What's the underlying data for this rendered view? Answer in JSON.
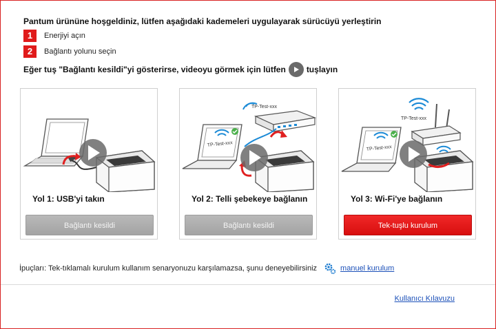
{
  "header": {
    "title": "Pantum ürününe hoşgeldiniz, lütfen aşağıdaki kademeleri uygulayarak sürücüyü  yerleştirin"
  },
  "steps": [
    {
      "number": "1",
      "text": "Enerjiyi açın"
    },
    {
      "number": "2",
      "text": "Bağlantı yolunu seçin"
    }
  ],
  "video_note": {
    "before": "Eğer tuş \"Bağlantı kesildi\"yi gösterirse, videoyu görmek için lütfen",
    "after": "tuşlayın"
  },
  "cards": [
    {
      "title": "Yol 1: USB'yi takın",
      "button": "Bağlantı kesildi",
      "button_state": "disabled"
    },
    {
      "title": "Yol 2: Telli şebekeye bağlanın",
      "button": "Bağlantı kesildi",
      "button_state": "disabled",
      "network_label": "TP-Test-xxx",
      "laptop_label": "TP-Test-xxx"
    },
    {
      "title": "Yol 3: Wi-Fi'ye bağlanın",
      "button": "Tek-tuşlu kurulum",
      "button_state": "enabled",
      "network_label": "TP-Test-xxx",
      "laptop_label": "TP-Test-xxx"
    }
  ],
  "tips": {
    "text": "İpuçları: Tek-tıklamalı kurulum kullanım senaryonuzu karşılamazsa, şunu deneyebilirsiniz",
    "link": "manuel kurulum"
  },
  "footer": {
    "guide_link": "Kullanıcı Kılavuzu"
  },
  "colors": {
    "accent": "#e01a1a",
    "disabled_button": "#adadad",
    "link": "#1a4fb8",
    "play_overlay": "#6a6a6a"
  },
  "icons": [
    "play-icon",
    "gear-icon",
    "wifi-icon",
    "check-icon",
    "usb-icon"
  ]
}
